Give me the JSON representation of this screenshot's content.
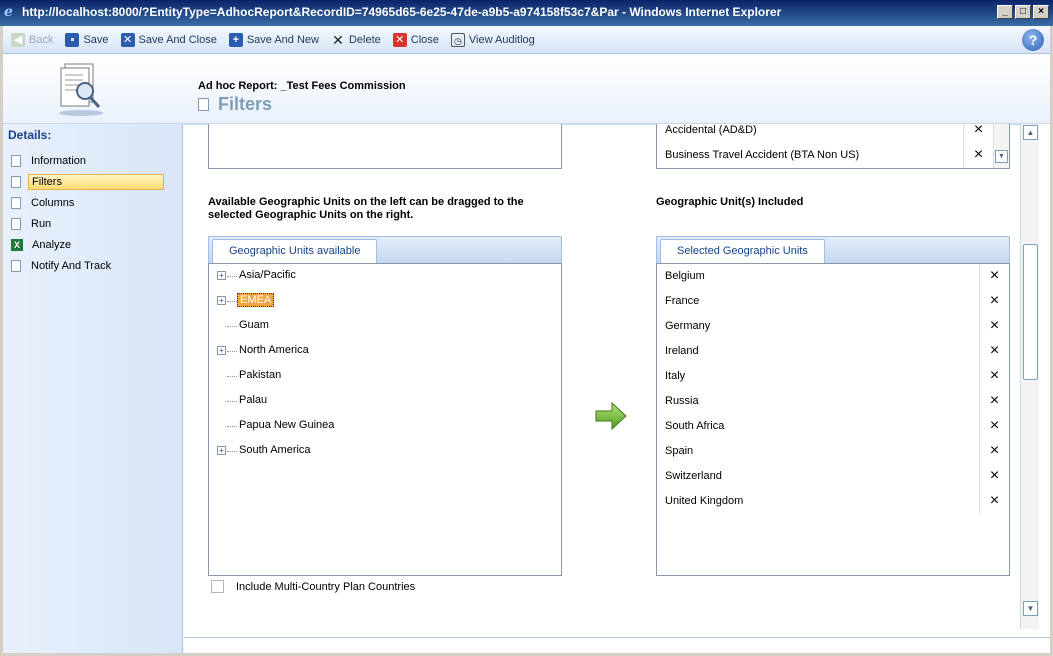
{
  "window": {
    "title": "http://localhost:8000/?EntityType=AdhocReport&RecordID=74965d65-6e25-47de-a9b5-a974158f53c7&Par - Windows Internet Explorer"
  },
  "toolbar": {
    "back": "Back",
    "save": "Save",
    "save_and_close": "Save And Close",
    "save_and_new": "Save And New",
    "delete": "Delete",
    "close": "Close",
    "view_auditlog": "View Auditlog",
    "help": "?"
  },
  "header": {
    "entity_title": "Ad hoc Report: _Test Fees Commission",
    "section_title": "Filters"
  },
  "sidebar": {
    "heading": "Details:",
    "items": [
      {
        "label": "Information"
      },
      {
        "label": "Filters"
      },
      {
        "label": "Columns"
      },
      {
        "label": "Run"
      },
      {
        "label": "Analyze"
      },
      {
        "label": "Notify And Track"
      }
    ]
  },
  "top_list": {
    "items": [
      "Accidental (AD&D)",
      "Business Travel Accident (BTA Non US)"
    ]
  },
  "available": {
    "instructions": "Available Geographic Units on the left can be dragged to the selected Geographic Units on the right.",
    "tab_label": "Geographic Units available",
    "tree": [
      {
        "label": "Asia/Pacific",
        "expandable": true
      },
      {
        "label": "EMEA",
        "expandable": true,
        "selected": true
      },
      {
        "label": "Guam",
        "expandable": false
      },
      {
        "label": "North America",
        "expandable": true
      },
      {
        "label": "Pakistan",
        "expandable": false
      },
      {
        "label": "Palau",
        "expandable": false
      },
      {
        "label": "Papua New Guinea",
        "expandable": false
      },
      {
        "label": "South America",
        "expandable": true
      }
    ]
  },
  "selected": {
    "heading": "Geographic Unit(s) Included",
    "tab_label": "Selected Geographic Units",
    "items": [
      "Belgium",
      "France",
      "Germany",
      "Ireland",
      "Italy",
      "Russia",
      "South Africa",
      "Spain",
      "Switzerland",
      "United Kingdom"
    ]
  },
  "options": {
    "include_multi_country": "Include Multi-Country Plan Countries"
  },
  "icons": {
    "remove": "×",
    "expand": "+"
  },
  "colors": {
    "accent": "#15428b",
    "selection": "#f4a340",
    "arrow": "#7dc142"
  }
}
